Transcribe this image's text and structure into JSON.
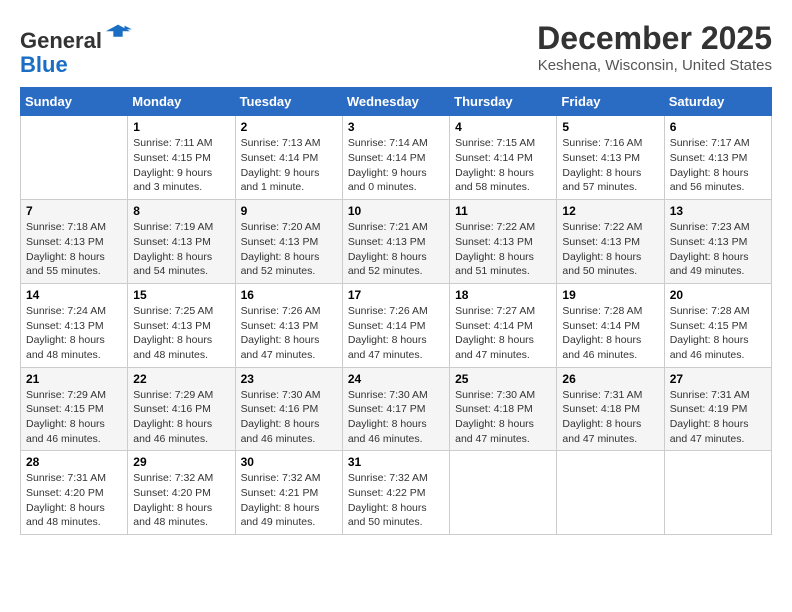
{
  "logo": {
    "general": "General",
    "blue": "Blue"
  },
  "header": {
    "month": "December 2025",
    "location": "Keshena, Wisconsin, United States"
  },
  "weekdays": [
    "Sunday",
    "Monday",
    "Tuesday",
    "Wednesday",
    "Thursday",
    "Friday",
    "Saturday"
  ],
  "weeks": [
    [
      {
        "day": "",
        "info": ""
      },
      {
        "day": "1",
        "info": "Sunrise: 7:11 AM\nSunset: 4:15 PM\nDaylight: 9 hours\nand 3 minutes."
      },
      {
        "day": "2",
        "info": "Sunrise: 7:13 AM\nSunset: 4:14 PM\nDaylight: 9 hours\nand 1 minute."
      },
      {
        "day": "3",
        "info": "Sunrise: 7:14 AM\nSunset: 4:14 PM\nDaylight: 9 hours\nand 0 minutes."
      },
      {
        "day": "4",
        "info": "Sunrise: 7:15 AM\nSunset: 4:14 PM\nDaylight: 8 hours\nand 58 minutes."
      },
      {
        "day": "5",
        "info": "Sunrise: 7:16 AM\nSunset: 4:13 PM\nDaylight: 8 hours\nand 57 minutes."
      },
      {
        "day": "6",
        "info": "Sunrise: 7:17 AM\nSunset: 4:13 PM\nDaylight: 8 hours\nand 56 minutes."
      }
    ],
    [
      {
        "day": "7",
        "info": "Sunrise: 7:18 AM\nSunset: 4:13 PM\nDaylight: 8 hours\nand 55 minutes."
      },
      {
        "day": "8",
        "info": "Sunrise: 7:19 AM\nSunset: 4:13 PM\nDaylight: 8 hours\nand 54 minutes."
      },
      {
        "day": "9",
        "info": "Sunrise: 7:20 AM\nSunset: 4:13 PM\nDaylight: 8 hours\nand 52 minutes."
      },
      {
        "day": "10",
        "info": "Sunrise: 7:21 AM\nSunset: 4:13 PM\nDaylight: 8 hours\nand 52 minutes."
      },
      {
        "day": "11",
        "info": "Sunrise: 7:22 AM\nSunset: 4:13 PM\nDaylight: 8 hours\nand 51 minutes."
      },
      {
        "day": "12",
        "info": "Sunrise: 7:22 AM\nSunset: 4:13 PM\nDaylight: 8 hours\nand 50 minutes."
      },
      {
        "day": "13",
        "info": "Sunrise: 7:23 AM\nSunset: 4:13 PM\nDaylight: 8 hours\nand 49 minutes."
      }
    ],
    [
      {
        "day": "14",
        "info": "Sunrise: 7:24 AM\nSunset: 4:13 PM\nDaylight: 8 hours\nand 48 minutes."
      },
      {
        "day": "15",
        "info": "Sunrise: 7:25 AM\nSunset: 4:13 PM\nDaylight: 8 hours\nand 48 minutes."
      },
      {
        "day": "16",
        "info": "Sunrise: 7:26 AM\nSunset: 4:13 PM\nDaylight: 8 hours\nand 47 minutes."
      },
      {
        "day": "17",
        "info": "Sunrise: 7:26 AM\nSunset: 4:14 PM\nDaylight: 8 hours\nand 47 minutes."
      },
      {
        "day": "18",
        "info": "Sunrise: 7:27 AM\nSunset: 4:14 PM\nDaylight: 8 hours\nand 47 minutes."
      },
      {
        "day": "19",
        "info": "Sunrise: 7:28 AM\nSunset: 4:14 PM\nDaylight: 8 hours\nand 46 minutes."
      },
      {
        "day": "20",
        "info": "Sunrise: 7:28 AM\nSunset: 4:15 PM\nDaylight: 8 hours\nand 46 minutes."
      }
    ],
    [
      {
        "day": "21",
        "info": "Sunrise: 7:29 AM\nSunset: 4:15 PM\nDaylight: 8 hours\nand 46 minutes."
      },
      {
        "day": "22",
        "info": "Sunrise: 7:29 AM\nSunset: 4:16 PM\nDaylight: 8 hours\nand 46 minutes."
      },
      {
        "day": "23",
        "info": "Sunrise: 7:30 AM\nSunset: 4:16 PM\nDaylight: 8 hours\nand 46 minutes."
      },
      {
        "day": "24",
        "info": "Sunrise: 7:30 AM\nSunset: 4:17 PM\nDaylight: 8 hours\nand 46 minutes."
      },
      {
        "day": "25",
        "info": "Sunrise: 7:30 AM\nSunset: 4:18 PM\nDaylight: 8 hours\nand 47 minutes."
      },
      {
        "day": "26",
        "info": "Sunrise: 7:31 AM\nSunset: 4:18 PM\nDaylight: 8 hours\nand 47 minutes."
      },
      {
        "day": "27",
        "info": "Sunrise: 7:31 AM\nSunset: 4:19 PM\nDaylight: 8 hours\nand 47 minutes."
      }
    ],
    [
      {
        "day": "28",
        "info": "Sunrise: 7:31 AM\nSunset: 4:20 PM\nDaylight: 8 hours\nand 48 minutes."
      },
      {
        "day": "29",
        "info": "Sunrise: 7:32 AM\nSunset: 4:20 PM\nDaylight: 8 hours\nand 48 minutes."
      },
      {
        "day": "30",
        "info": "Sunrise: 7:32 AM\nSunset: 4:21 PM\nDaylight: 8 hours\nand 49 minutes."
      },
      {
        "day": "31",
        "info": "Sunrise: 7:32 AM\nSunset: 4:22 PM\nDaylight: 8 hours\nand 50 minutes."
      },
      {
        "day": "",
        "info": ""
      },
      {
        "day": "",
        "info": ""
      },
      {
        "day": "",
        "info": ""
      }
    ]
  ]
}
